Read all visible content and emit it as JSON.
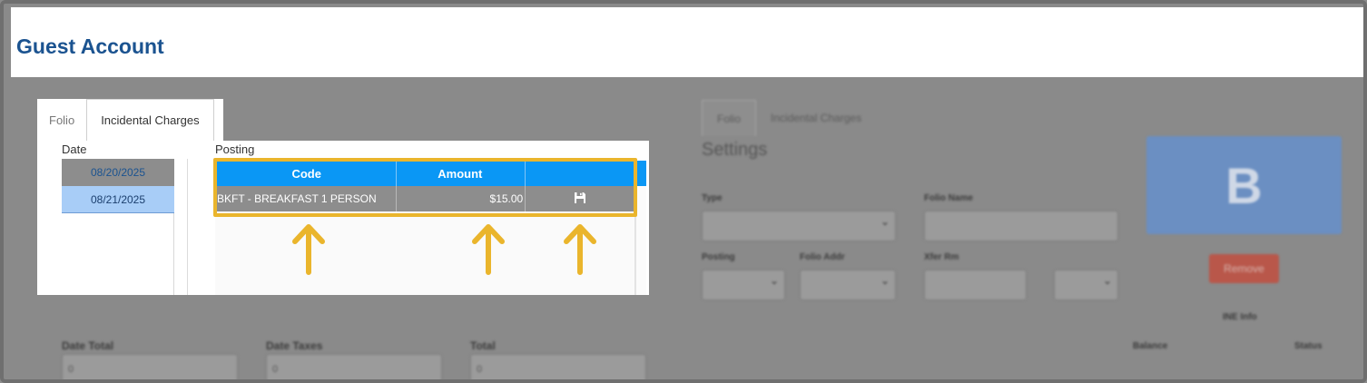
{
  "header": {
    "title": "Guest Account"
  },
  "panel": {
    "tabs": [
      {
        "label": "Folio",
        "active": false
      },
      {
        "label": "Incidental Charges",
        "active": true
      }
    ],
    "date_header": "Date",
    "posting_header": "Posting",
    "dates": [
      {
        "value": "08/20/2025",
        "state": "gray"
      },
      {
        "value": "08/21/2025",
        "state": "selected"
      }
    ],
    "grid": {
      "columns": [
        "Code",
        "Amount",
        ""
      ],
      "rows": [
        {
          "code": "BKFT - BREAKFAST 1 PERSON",
          "amount": "$15.00",
          "action_icon": "save-icon"
        }
      ]
    }
  },
  "background": {
    "tabs": [
      "Folio",
      "Incidental Charges"
    ],
    "settings_title": "Settings",
    "labels": {
      "type": "Type",
      "folio_name": "Folio Name",
      "posting": "Posting",
      "folio_addr": "Folio Addr",
      "xfer_rm": "Xfer Rm",
      "ine_info": "INE Info",
      "date_total": "Date Total",
      "date_taxes": "Date Taxes",
      "total": "Total",
      "balance": "Balance",
      "status": "Status"
    },
    "avatar_letter": "B",
    "remove_label": "Remove",
    "totals": {
      "date_total": "0",
      "date_taxes": "0",
      "total": "0"
    }
  },
  "colors": {
    "title": "#1b5390",
    "grid_header": "#0a97f5",
    "highlight": "#eab52c",
    "selected_date": "#a8cdf7",
    "remove_button": "#b9574a",
    "avatar": "#6b8fc2"
  }
}
